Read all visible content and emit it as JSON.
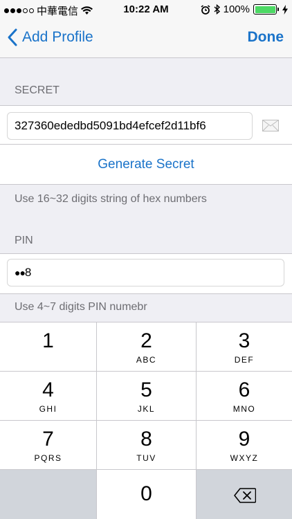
{
  "status_bar": {
    "carrier": "中華電信",
    "time": "10:22 AM",
    "battery": "100%",
    "icons": [
      "signal-dots-icon",
      "wifi-icon",
      "alarm-icon",
      "bluetooth-icon",
      "battery-icon",
      "charging-icon"
    ]
  },
  "nav": {
    "back_label": "Add Profile",
    "done_label": "Done"
  },
  "secret_section": {
    "header": "SECRET",
    "value": "327360ededbd5091bd4efcef2d11bf6",
    "generate_label": "Generate Secret",
    "note": "Use 16~32 digits string of hex numbers"
  },
  "pin_section": {
    "header": "PIN",
    "masked": "●●",
    "last_char": "8",
    "note": "Use 4~7 digits PIN numebr"
  },
  "keypad": {
    "keys": [
      {
        "digit": "1",
        "letters": ""
      },
      {
        "digit": "2",
        "letters": "ABC"
      },
      {
        "digit": "3",
        "letters": "DEF"
      },
      {
        "digit": "4",
        "letters": "GHI"
      },
      {
        "digit": "5",
        "letters": "JKL"
      },
      {
        "digit": "6",
        "letters": "MNO"
      },
      {
        "digit": "7",
        "letters": "PQRS"
      },
      {
        "digit": "8",
        "letters": "TUV"
      },
      {
        "digit": "9",
        "letters": "WXYZ"
      },
      {
        "digit": "0",
        "letters": ""
      }
    ],
    "key_bg": "#ffffff",
    "gray_key_bg": "#d1d5db"
  },
  "colors": {
    "accent": "#1a73c9",
    "background": "#efeff4",
    "battery_fill": "#4cd964"
  }
}
